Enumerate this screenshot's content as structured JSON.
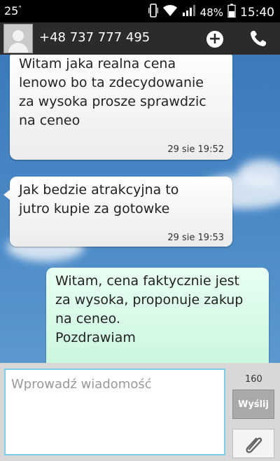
{
  "status_bar": {
    "temperature": "25",
    "degree": "°",
    "battery": "48%",
    "time": "15:40"
  },
  "header": {
    "contact_number": "+48 737 777 495",
    "add_icon": "plus-circle-icon",
    "call_icon": "phone-icon"
  },
  "messages": [
    {
      "direction": "incoming",
      "text": "Witam jaka realna cena\nlenowo bo ta zdecydowanie\nza wysoka prosze sprawdzic\nna ceneo",
      "time": "29 sie 19:52"
    },
    {
      "direction": "incoming",
      "text": "Jak bedzie atrakcyjna to\njutro kupie za gotowke",
      "time": "29 sie 19:53"
    },
    {
      "direction": "outgoing",
      "text": "Witam, cena faktycznie jest\nza wysoka, proponuje zakup\nna ceneo.\nPozdrawiam",
      "time": ""
    }
  ],
  "compose": {
    "placeholder": "Wprowadź wiadomość",
    "char_count": "160",
    "send_label": "Wyślij",
    "attach_icon": "paperclip-icon"
  },
  "colors": {
    "background_sky": "#3a78b8",
    "outgoing_bubble": "#c8f5dc",
    "incoming_bubble": "#ffffff",
    "input_border": "#7fcde8"
  }
}
